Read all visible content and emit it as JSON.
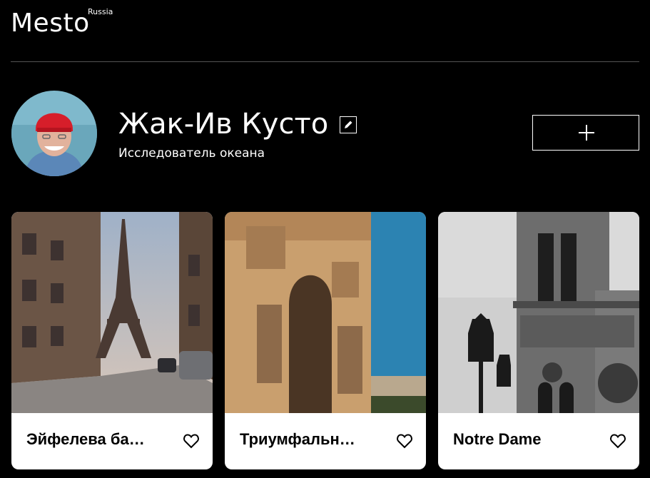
{
  "header": {
    "logo": "Mesto",
    "logo_sup": "Russia"
  },
  "profile": {
    "name": "Жак-Ив Кусто",
    "about": "Исследователь океана",
    "edit_icon": "pencil-icon",
    "add_icon": "plus-icon"
  },
  "cards": [
    {
      "title": "Эйфелева ба…",
      "like_icon": "heart-outline-icon"
    },
    {
      "title": "Триумфальн…",
      "like_icon": "heart-outline-icon"
    },
    {
      "title": "Notre Dame",
      "like_icon": "heart-outline-icon"
    }
  ],
  "colors": {
    "background": "#000000",
    "divider": "#545454",
    "card": "#ffffff"
  }
}
